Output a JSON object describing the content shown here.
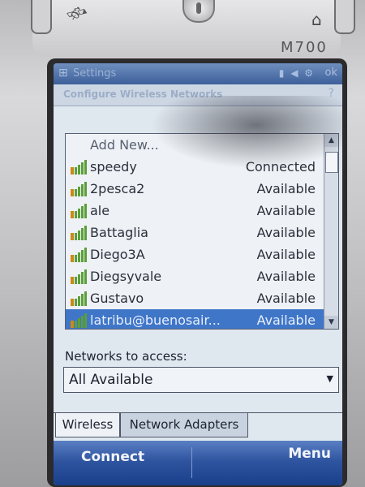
{
  "device": {
    "model": "M700"
  },
  "titlebar": {
    "app_title": "Settings",
    "ok_label": "ok"
  },
  "header": {
    "title": "Configure Wireless Networks"
  },
  "networks": {
    "add_new_label": "Add New...",
    "items": [
      {
        "name": "speedy",
        "status": "Connected"
      },
      {
        "name": "2pesca2",
        "status": "Available"
      },
      {
        "name": "ale",
        "status": "Available"
      },
      {
        "name": "Battaglia",
        "status": "Available"
      },
      {
        "name": "Diego3A",
        "status": "Available"
      },
      {
        "name": "Diegsyvale",
        "status": "Available"
      },
      {
        "name": "Gustavo",
        "status": "Available"
      },
      {
        "name": "latribu@buenosair...",
        "status": "Available"
      }
    ],
    "selected_index": 7
  },
  "access": {
    "label": "Networks to access:",
    "selected": "All Available"
  },
  "tabs": {
    "wireless": "Wireless",
    "network_adapters": "Network Adapters"
  },
  "softkeys": {
    "left": "Connect",
    "right": "Menu"
  },
  "colors": {
    "softkey_bar": "#2f55a0",
    "selection": "#3f76c8",
    "signal_bar": "#5b9e3a"
  }
}
